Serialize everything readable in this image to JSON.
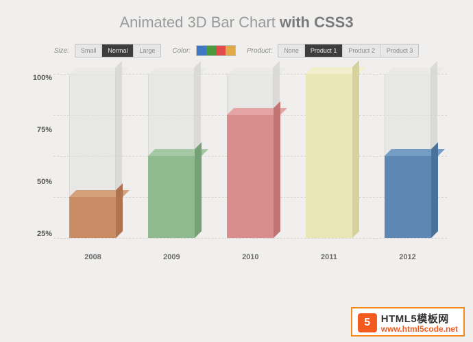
{
  "title": {
    "pre": "Animated 3D Bar Chart ",
    "bold": "with CSS3"
  },
  "toolbar": {
    "size_label": "Size:",
    "sizes": [
      "Small",
      "Normal",
      "Large"
    ],
    "size_active": 1,
    "color_label": "Color:",
    "swatches": [
      "#3f78c2",
      "#4a9a3d",
      "#e24b4b",
      "#e2a94b"
    ],
    "product_label": "Product:",
    "products": [
      "None",
      "Product 1",
      "Product 2",
      "Product 3"
    ],
    "product_active": 1
  },
  "axis_ticks": [
    "100%",
    "75%",
    "50%",
    "25%"
  ],
  "x_categories": [
    "2008",
    "2009",
    "2010",
    "2011",
    "2012"
  ],
  "bar_colors": [
    {
      "front": "#c98c64",
      "top": "#d6a07c",
      "side": "#b07350"
    },
    {
      "front": "#8fb98f",
      "top": "#a4c9a4",
      "side": "#76a176"
    },
    {
      "front": "#d98d8d",
      "top": "#e4a4a4",
      "side": "#c17474"
    },
    {
      "front": "#e9e6b8",
      "top": "#f1efcc",
      "side": "#d6d29e"
    },
    {
      "front": "#5d88b3",
      "top": "#759ec6",
      "side": "#4a7199"
    }
  ],
  "chart_data": {
    "type": "bar",
    "title": "Animated 3D Bar Chart with CSS3",
    "categories": [
      "2008",
      "2009",
      "2010",
      "2011",
      "2012"
    ],
    "values": [
      25,
      50,
      75,
      100,
      50
    ],
    "xlabel": "",
    "ylabel": "",
    "ylim": [
      0,
      100
    ],
    "y_ticks": [
      25,
      50,
      75,
      100
    ],
    "y_tick_format": "percent"
  },
  "watermark": {
    "badge": "5",
    "line1": "HTML5模板网",
    "line2": "www.html5code.net"
  }
}
